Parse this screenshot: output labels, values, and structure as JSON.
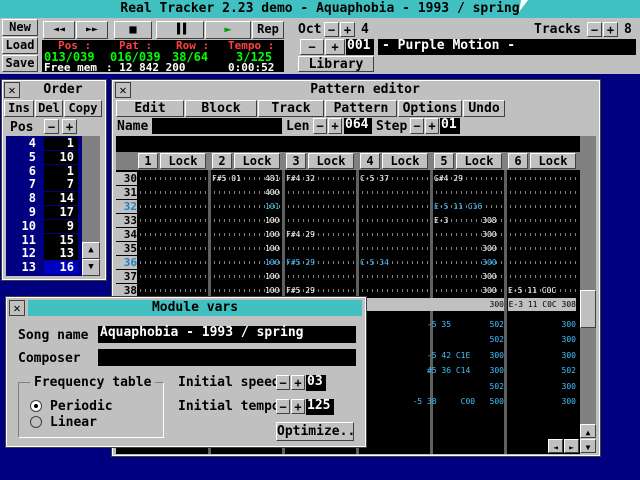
{
  "app": {
    "title": "Real Tracker 2.23 demo - Aquaphobia  - 1993 / spring"
  },
  "toolbar": {
    "file_buttons": [
      "New",
      "Load",
      "Save"
    ],
    "transport": [
      "◄◄",
      "►►",
      "■",
      "▐▐",
      "►",
      "Rep"
    ],
    "status_labels": [
      "Pos :",
      "Pat :",
      "Row :",
      "Tempo :"
    ],
    "status_values": [
      "013/039",
      "016/039",
      "38/64",
      "3/125"
    ],
    "free_mem_label": "Free mem",
    "free_mem_value": ": 12 842 200",
    "time": "0:00:52",
    "oct_label": "Oct",
    "oct_value": "4",
    "song_index": "001",
    "song_name": "- Purple Motion -",
    "library_label": "Library",
    "tracks_label": "Tracks",
    "tracks_value": "8"
  },
  "order": {
    "title": "Order",
    "buttons": [
      "Ins",
      "Del",
      "Copy"
    ],
    "pos_label": "Pos",
    "rows": [
      {
        "pos": "4",
        "val": "1"
      },
      {
        "pos": "5",
        "val": "10"
      },
      {
        "pos": "6",
        "val": "1"
      },
      {
        "pos": "7",
        "val": "7"
      },
      {
        "pos": "8",
        "val": "14"
      },
      {
        "pos": "9",
        "val": "17"
      },
      {
        "pos": "10",
        "val": "9"
      },
      {
        "pos": "11",
        "val": "15"
      },
      {
        "pos": "12",
        "val": "13"
      },
      {
        "pos": "13",
        "val": "16"
      }
    ]
  },
  "pattern_editor": {
    "title": "Pattern editor",
    "menu": [
      "Edit",
      "Block",
      "Track",
      "Pattern",
      "Options",
      "Undo"
    ],
    "name_label": "Name",
    "len_label": "Len",
    "len_value": "064",
    "step_label": "Step",
    "step_value": "01",
    "tracks": [
      "1",
      "2",
      "3",
      "4",
      "5",
      "6"
    ],
    "lock_label": "Lock",
    "row_numbers": [
      "30",
      "31",
      "32",
      "33",
      "34",
      "35",
      "36",
      "37",
      "38"
    ],
    "cells": [
      [
        "",
        "F#5 01     481",
        "F#4 32",
        "C-5 37",
        "G#4 29",
        ""
      ],
      [
        "",
        "           400",
        "",
        "",
        "",
        ""
      ],
      [
        "",
        "           101",
        "",
        "",
        "E-5 11 C16",
        ""
      ],
      [
        "",
        "           100",
        "",
        "",
        "E-3       308",
        ""
      ],
      [
        "",
        "           100",
        "F#4 29",
        "",
        "          300",
        ""
      ],
      [
        "",
        "           100",
        "",
        "",
        "          300",
        ""
      ],
      [
        "",
        "           100",
        "F#5 29",
        "C-5 34",
        "          300",
        ""
      ],
      [
        "",
        "           100",
        "",
        "",
        "          300",
        ""
      ],
      [
        "",
        "           100",
        "F#5 29",
        "",
        "          300",
        "E-5 11 C0C"
      ]
    ],
    "lower_cells": [
      [
        "      300",
        "E-3 11 C0C 308"
      ],
      [
        "-5 35        502",
        "300"
      ],
      [
        "          502",
        "300"
      ],
      [
        "-5 42 C1E    300",
        "300"
      ],
      [
        "#5 36 C14    300",
        "502"
      ],
      [
        "          502",
        "300"
      ],
      [
        "-5 38     C00   500",
        "300"
      ]
    ]
  },
  "module_vars": {
    "title": "Module vars",
    "song_name_label": "Song name",
    "song_name_value": "Aquaphobia  - 1993 / spring",
    "composer_label": "Composer",
    "composer_value": "",
    "freq_table_label": "Frequency table",
    "freq_options": [
      "Periodic",
      "Linear"
    ],
    "initial_speed_label": "Initial speed",
    "initial_speed_value": "03",
    "initial_tempo_label": "Initial tempo",
    "initial_tempo_value": "125",
    "optimize_label": "Optimize..."
  },
  "colors": {
    "desktop": "#000080",
    "title_bar": "#40c0c0",
    "highlight_text": "#40c0ff",
    "status_green": "#00ff00",
    "status_red": "#ff4040"
  }
}
